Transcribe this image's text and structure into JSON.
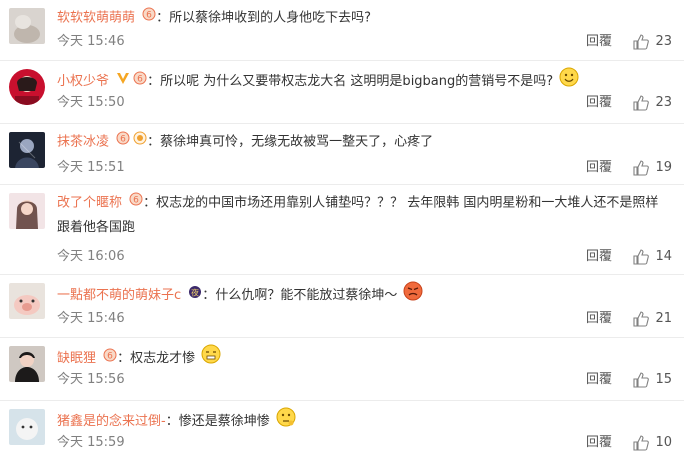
{
  "reply_label": "回覆",
  "colors": {
    "name": "#eb7350",
    "text": "#333333",
    "meta": "#808080",
    "divider": "#ececec"
  },
  "comments": [
    {
      "username": "软软软萌萌萌",
      "text": "所以蔡徐坤收到的人身他吃下去吗?",
      "time": "今天 15:46",
      "likes": "23",
      "badges": [
        "member-badge-icon"
      ]
    },
    {
      "username": "小权少爷",
      "text": "所以呢 为什么又要带权志龙大名 这明明是bigbang的营销号不是吗?",
      "time": "今天 15:50",
      "likes": "23",
      "badges": [
        "verified-v-icon",
        "member-badge-icon"
      ],
      "emoji": "smile-emoji"
    },
    {
      "username": "抹茶冰凌",
      "text": "蔡徐坤真可怜，无缘无故被骂一整天了，心疼了",
      "time": "今天 15:51",
      "likes": "19",
      "badges": [
        "member-badge-icon",
        "fan-badge-icon"
      ]
    },
    {
      "username": "改了个暱称",
      "text": "权志龙的中国市场还用靠别人铺垫吗？？？ 去年限韩 国内明星粉和一大堆人还不是照样跟着他各国跑",
      "time": "今天 16:06",
      "likes": "14",
      "badges": [
        "member-badge-icon"
      ]
    },
    {
      "username": "一點都不萌的萌妹子c",
      "text": "什么仇啊？能不能放过蔡徐坤～",
      "time": "今天 15:46",
      "likes": "21",
      "badges": [
        "night-badge-icon"
      ],
      "emoji": "angry-emoji"
    },
    {
      "username": "缺眠狸",
      "text": "权志龙才惨",
      "time": "今天 15:56",
      "likes": "15",
      "badges": [
        "member-badge-icon"
      ],
      "emoji": "grimace-emoji"
    },
    {
      "username": "猪鑫是的念来过倒-",
      "text": "惨还是蔡徐坤惨",
      "time": "今天 15:59",
      "likes": "10",
      "badges": [],
      "emoji": "thinking-emoji"
    }
  ]
}
